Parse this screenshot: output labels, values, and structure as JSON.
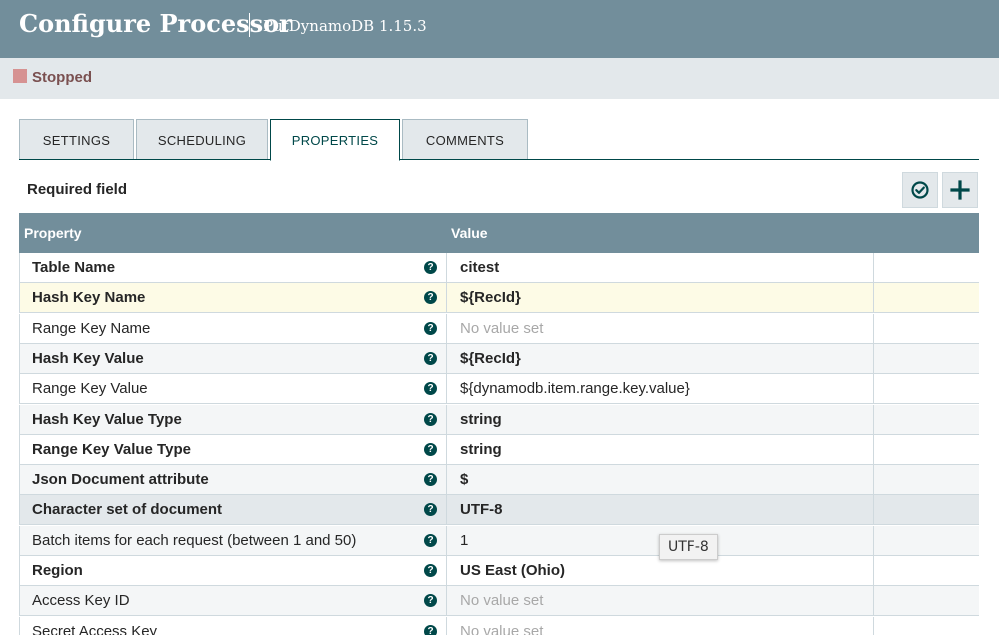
{
  "header": {
    "title": "Configure Processor",
    "subtitle": "PutDynamoDB 1.15.3"
  },
  "status": {
    "label": "Stopped",
    "color": "#d69292"
  },
  "tabs": [
    {
      "label": "SETTINGS",
      "active": false
    },
    {
      "label": "SCHEDULING",
      "active": false
    },
    {
      "label": "PROPERTIES",
      "active": true
    },
    {
      "label": "COMMENTS",
      "active": false
    }
  ],
  "properties_panel": {
    "required_label": "Required field",
    "verify_icon": "check-circle-icon",
    "add_icon": "plus-icon"
  },
  "grid": {
    "columns": {
      "property": "Property",
      "value": "Value"
    },
    "rows": [
      {
        "name": "Table Name",
        "required": true,
        "value": "citest",
        "value_set": true
      },
      {
        "name": "Hash Key Name",
        "required": true,
        "value": "${RecId}",
        "value_set": true
      },
      {
        "name": "Range Key Name",
        "required": false,
        "value": "No value set",
        "value_set": false
      },
      {
        "name": "Hash Key Value",
        "required": true,
        "value": "${RecId}",
        "value_set": true
      },
      {
        "name": "Range Key Value",
        "required": false,
        "value": "${dynamodb.item.range.key.value}",
        "value_set": true
      },
      {
        "name": "Hash Key Value Type",
        "required": true,
        "value": "string",
        "value_set": true
      },
      {
        "name": "Range Key Value Type",
        "required": true,
        "value": "string",
        "value_set": true
      },
      {
        "name": "Json Document attribute",
        "required": true,
        "value": "$",
        "value_set": true
      },
      {
        "name": "Character set of document",
        "required": true,
        "value": "UTF-8",
        "value_set": true
      },
      {
        "name": "Batch items for each request (between 1 and 50)",
        "required": false,
        "value": "1",
        "value_set": true
      },
      {
        "name": "Region",
        "required": true,
        "value": "US East (Ohio)",
        "value_set": true
      },
      {
        "name": "Access Key ID",
        "required": false,
        "value": "No value set",
        "value_set": false
      },
      {
        "name": "Secret Access Key",
        "required": false,
        "value": "No value set",
        "value_set": false
      }
    ],
    "highlight_colors": {
      "selected": "#fdfbe6",
      "hover": "#e3e8eb",
      "stripe": "#f4f6f7"
    }
  },
  "tooltip": {
    "text": "UTF-8"
  }
}
